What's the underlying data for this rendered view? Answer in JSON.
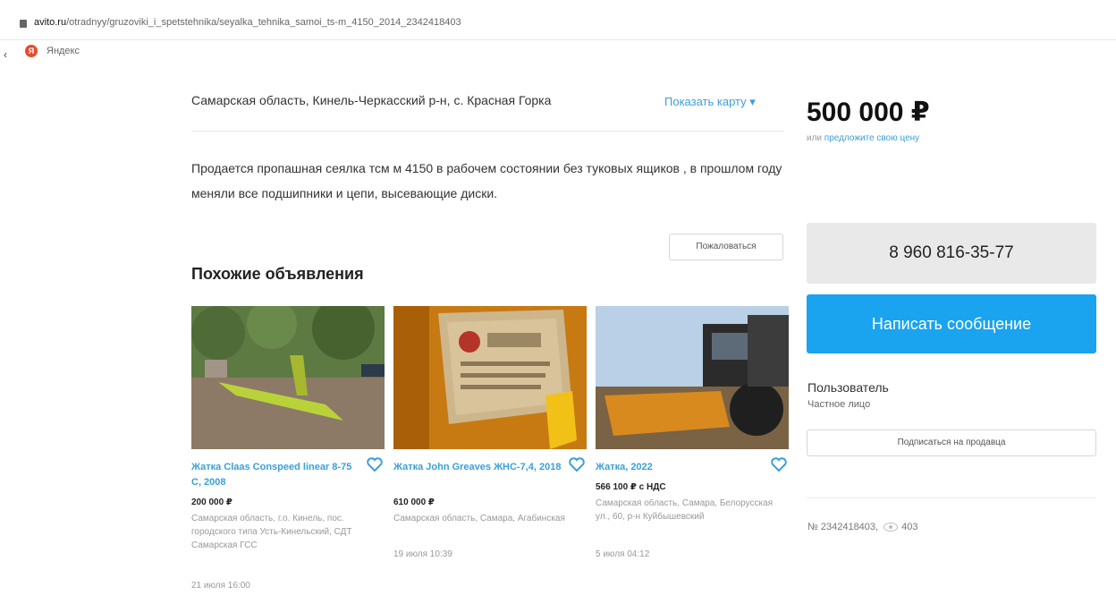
{
  "browser": {
    "url_domain": "avito.ru",
    "url_path": "/otradnyy/gruzoviki_i_spetstehnika/seyalka_tehnika_samoi_ts-m_4150_2014_2342418403",
    "bookmark_label": "Яндекс"
  },
  "listing": {
    "location": "Самарская область, Кинель-Черкасский р-н, с. Красная Горка",
    "map_link": "Показать карту",
    "description": "Продается пропашная сеялка тсм м 4150 в рабочем состоянии без туковых ящиков , в прошлом году меняли все подшипники и цепи, высевающие диски.",
    "report_label": "Пожаловаться",
    "ad_number": "№ 2342418403,",
    "views": "403"
  },
  "similar": {
    "title": "Похожие объявления",
    "items": [
      {
        "title": "Жатка Claas Conspeed linear 8-75 C, 2008",
        "price": "200 000 ₽",
        "address": "Самарская область, г.о. Кинель, пос. городского типа Усть-Кинельский, СДТ Самарская ГСС",
        "date": "21 июля 16:00"
      },
      {
        "title": "Жатка John Greaves ЖНС-7,4, 2018",
        "price": "610 000 ₽",
        "address": "Самарская область, Самара, Агабинская",
        "date": "19 июля 10:39"
      },
      {
        "title": "Жатка, 2022",
        "price": "566 100 ₽ с НДС",
        "address": "Самарская область, Самара, Белорусская ул., 60, р-н Куйбышевский",
        "date": "5 июля 04:12"
      }
    ]
  },
  "sidebar": {
    "price": "500 000 ₽",
    "offer_prefix": "или",
    "offer_link": "предложите свою цену",
    "phone": "8 960 816-35-77",
    "message_button": "Написать сообщение",
    "seller_name": "Пользователь",
    "seller_type": "Частное лицо",
    "subscribe_button": "Подписаться на продавца"
  },
  "colors": {
    "accent": "#1aa3ee",
    "link": "#3b9fd8",
    "muted": "#999999"
  }
}
